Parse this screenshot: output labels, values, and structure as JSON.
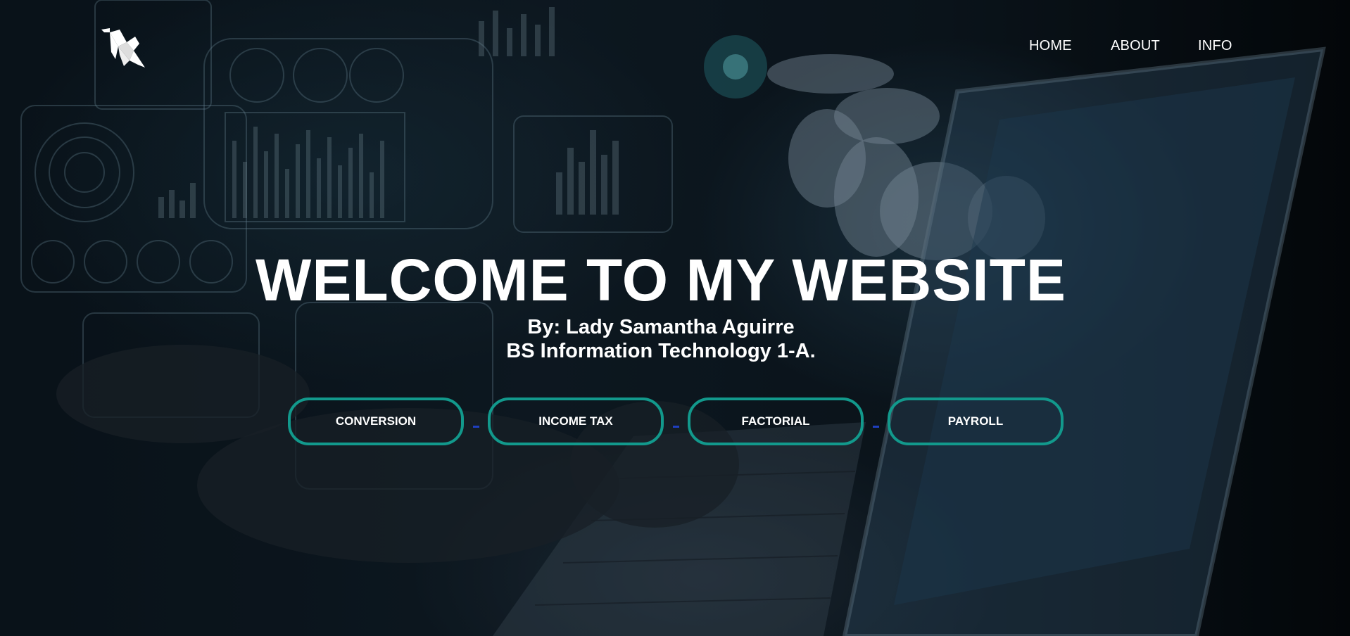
{
  "header": {
    "logo_icon": "origami-bird-logo-icon",
    "nav": [
      {
        "label": "HOME"
      },
      {
        "label": "ABOUT"
      },
      {
        "label": "INFO"
      }
    ]
  },
  "hero": {
    "title": "WELCOME TO MY WEBSITE",
    "byline": "By: Lady Samantha Aguirre",
    "program": "BS Information Technology 1-A."
  },
  "buttons": [
    {
      "label": "CONVERSION"
    },
    {
      "label": "INCOME TAX"
    },
    {
      "label": "FACTORIAL"
    },
    {
      "label": "PAYROLL"
    }
  ],
  "colors": {
    "button_border": "#12998c",
    "separator": "#1f3fbf",
    "text": "#ffffff"
  }
}
